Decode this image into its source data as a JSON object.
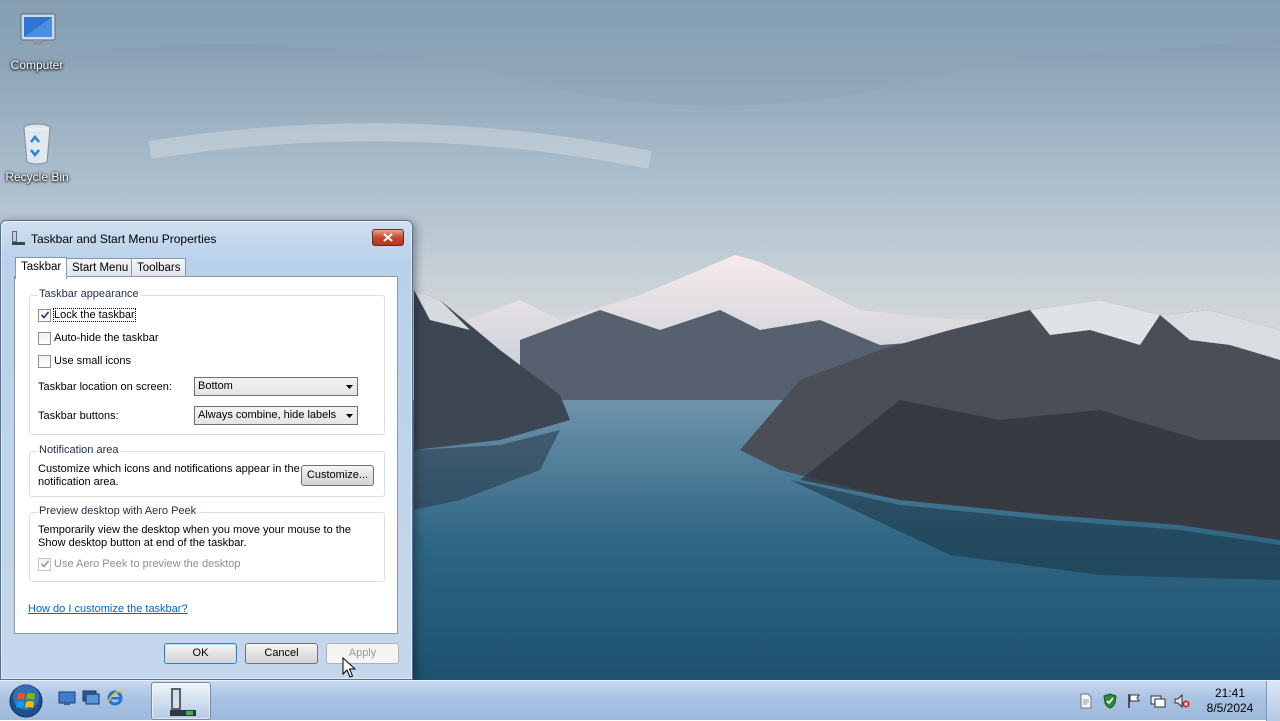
{
  "desktop": {
    "icons": [
      {
        "label": "Computer",
        "icon": "computer-icon"
      },
      {
        "label": "Recycle Bin",
        "icon": "recycle-bin-icon"
      }
    ]
  },
  "dialog": {
    "title": "Taskbar and Start Menu Properties",
    "tabs": [
      {
        "label": "Taskbar",
        "active": true
      },
      {
        "label": "Start Menu",
        "active": false
      },
      {
        "label": "Toolbars",
        "active": false
      }
    ],
    "appearance": {
      "title": "Taskbar appearance",
      "lock_taskbar": {
        "label": "Lock the taskbar",
        "checked": true
      },
      "auto_hide": {
        "label": "Auto-hide the taskbar",
        "checked": false
      },
      "small_icons": {
        "label": "Use small icons",
        "checked": false
      },
      "location_label": "Taskbar location on screen:",
      "location_value": "Bottom",
      "buttons_label": "Taskbar buttons:",
      "buttons_value": "Always combine, hide labels"
    },
    "notification": {
      "title": "Notification area",
      "text_line1": "Customize which icons and notifications appear in the",
      "text_line2": "notification area.",
      "customize_label": "Customize..."
    },
    "peek": {
      "title": "Preview desktop with Aero Peek",
      "text_line1": "Temporarily view the desktop when you move your mouse to the",
      "text_line2": "Show desktop button at end of the taskbar.",
      "use_peek": {
        "label": "Use Aero Peek to preview the desktop",
        "checked": true,
        "disabled": true
      }
    },
    "help_link": "How do I customize the taskbar?",
    "buttons": {
      "ok": "OK",
      "cancel": "Cancel",
      "apply": "Apply"
    }
  },
  "taskbar": {
    "clock": {
      "time": "21:41",
      "date": "8/5/2024"
    },
    "quick_launch": [
      "show-desktop-icon",
      "switch-windows-icon",
      "internet-explorer-icon"
    ],
    "tray": [
      "document-icon",
      "security-shield-icon",
      "action-center-flag-icon",
      "network-icon",
      "volume-muted-icon"
    ]
  }
}
